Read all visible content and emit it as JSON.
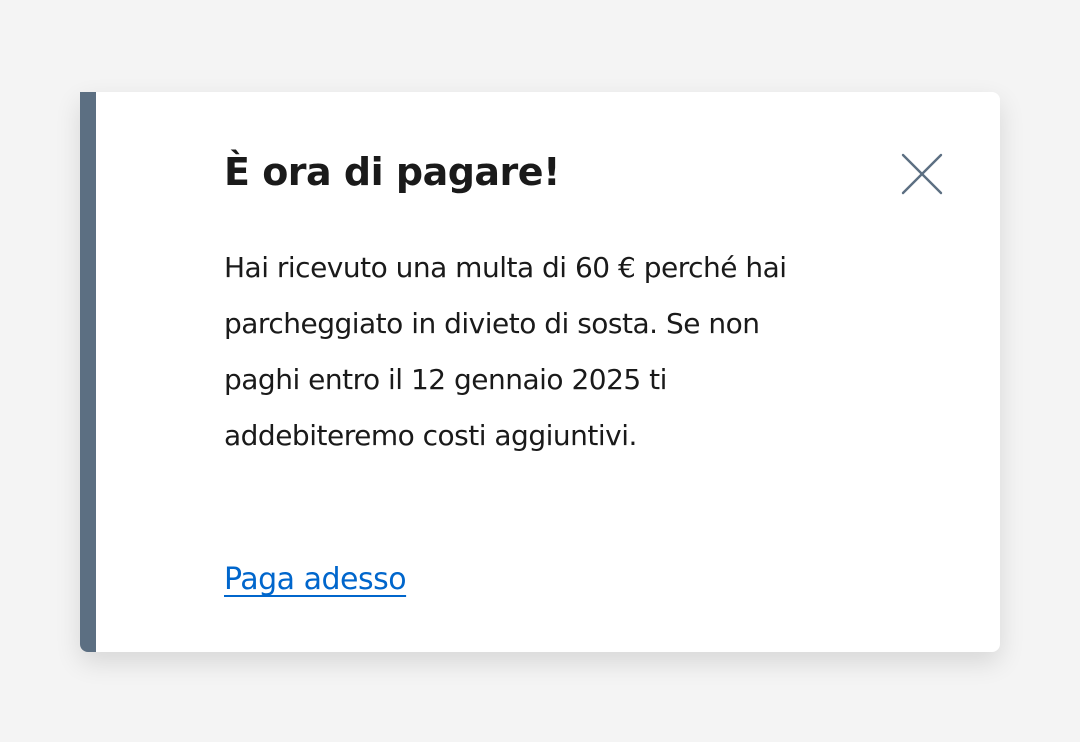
{
  "notification": {
    "title": "È ora di pagare!",
    "message": "Hai ricevuto una multa di 60 € perché hai parcheggiato in divieto di sosta. Se non paghi entro il 12 gennaio 2025 ti addebiteremo costi aggiuntivi.",
    "action_label": "Paga adesso",
    "close_icon": "close-icon"
  },
  "colors": {
    "accent_border": "#5c6f82",
    "link": "#0066cc",
    "text": "#1a1a1a",
    "background": "#f4f4f4",
    "card": "#ffffff"
  }
}
